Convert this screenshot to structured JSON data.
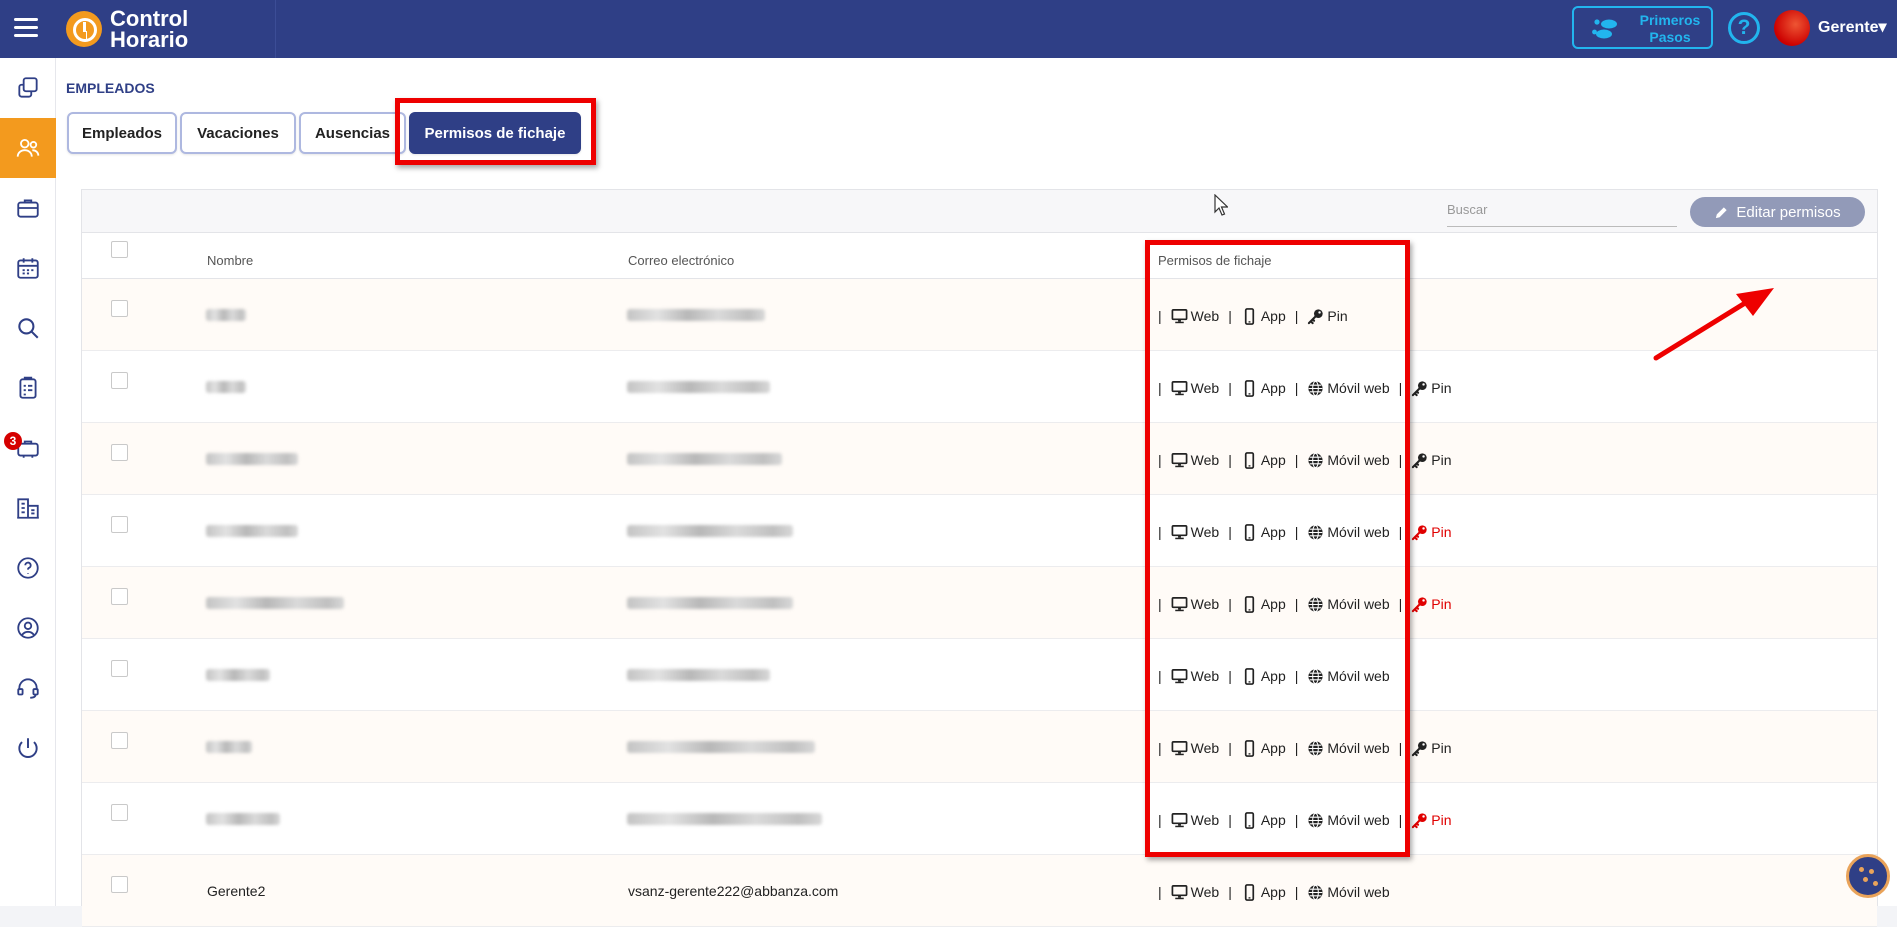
{
  "app": {
    "logo_line1": "Control",
    "logo_line2": "Horario",
    "primeros_line1": "Primeros",
    "primeros_line2": "Pasos",
    "help_glyph": "?",
    "user_name": "Gerente",
    "user_caret": "▾"
  },
  "sidebar": {
    "items": [
      {
        "name": "copy-icon"
      },
      {
        "name": "users-icon",
        "active": true
      },
      {
        "name": "briefcase-icon"
      },
      {
        "name": "calendar-icon"
      },
      {
        "name": "search-icon"
      },
      {
        "name": "clipboard-icon"
      },
      {
        "name": "travel-bag-icon",
        "badge": "3"
      },
      {
        "name": "buildings-icon"
      },
      {
        "name": "help-icon"
      },
      {
        "name": "user-circle-icon"
      },
      {
        "name": "headset-icon"
      },
      {
        "name": "power-icon"
      }
    ]
  },
  "page": {
    "section_title": "EMPLEADOS",
    "tabs": [
      {
        "label": "Empleados"
      },
      {
        "label": "Vacaciones"
      },
      {
        "label": "Ausencias"
      },
      {
        "label": "Permisos de fichaje",
        "active": true
      }
    ]
  },
  "table": {
    "search_placeholder": "Buscar",
    "edit_label": "Editar permisos",
    "headers": {
      "name": "Nombre",
      "email": "Correo electrónico",
      "perms": "Permisos de fichaje"
    },
    "perm_labels": {
      "web": "Web",
      "app": "App",
      "movil": "Móvil web",
      "pin": "Pin",
      "sep": "|"
    },
    "rows": [
      {
        "name": "",
        "email": "",
        "perms": [
          "web",
          "app",
          "pin"
        ],
        "pin_red": false
      },
      {
        "name": "",
        "email": "",
        "perms": [
          "web",
          "app",
          "movil",
          "pin"
        ],
        "pin_red": false
      },
      {
        "name": "",
        "email": "",
        "perms": [
          "web",
          "app",
          "movil",
          "pin"
        ],
        "pin_red": false
      },
      {
        "name": "",
        "email": "",
        "perms": [
          "web",
          "app",
          "movil",
          "pin"
        ],
        "pin_red": true
      },
      {
        "name": "",
        "email": "",
        "perms": [
          "web",
          "app",
          "movil",
          "pin"
        ],
        "pin_red": true
      },
      {
        "name": "",
        "email": "",
        "perms": [
          "web",
          "app",
          "movil"
        ],
        "pin_red": false
      },
      {
        "name": "",
        "email": "",
        "perms": [
          "web",
          "app",
          "movil",
          "pin"
        ],
        "pin_red": false
      },
      {
        "name": "",
        "email": "",
        "perms": [
          "web",
          "app",
          "movil",
          "pin"
        ],
        "pin_red": true
      },
      {
        "name": "Gerente2",
        "email": "vsanz-gerente222@abbanza.com",
        "perms": [
          "web",
          "app",
          "movil"
        ],
        "pin_red": false
      }
    ]
  },
  "colors": {
    "brand": "#2f3f86",
    "accent": "#f39a1e",
    "highlight": "#ee0000",
    "info": "#22b5ee"
  }
}
